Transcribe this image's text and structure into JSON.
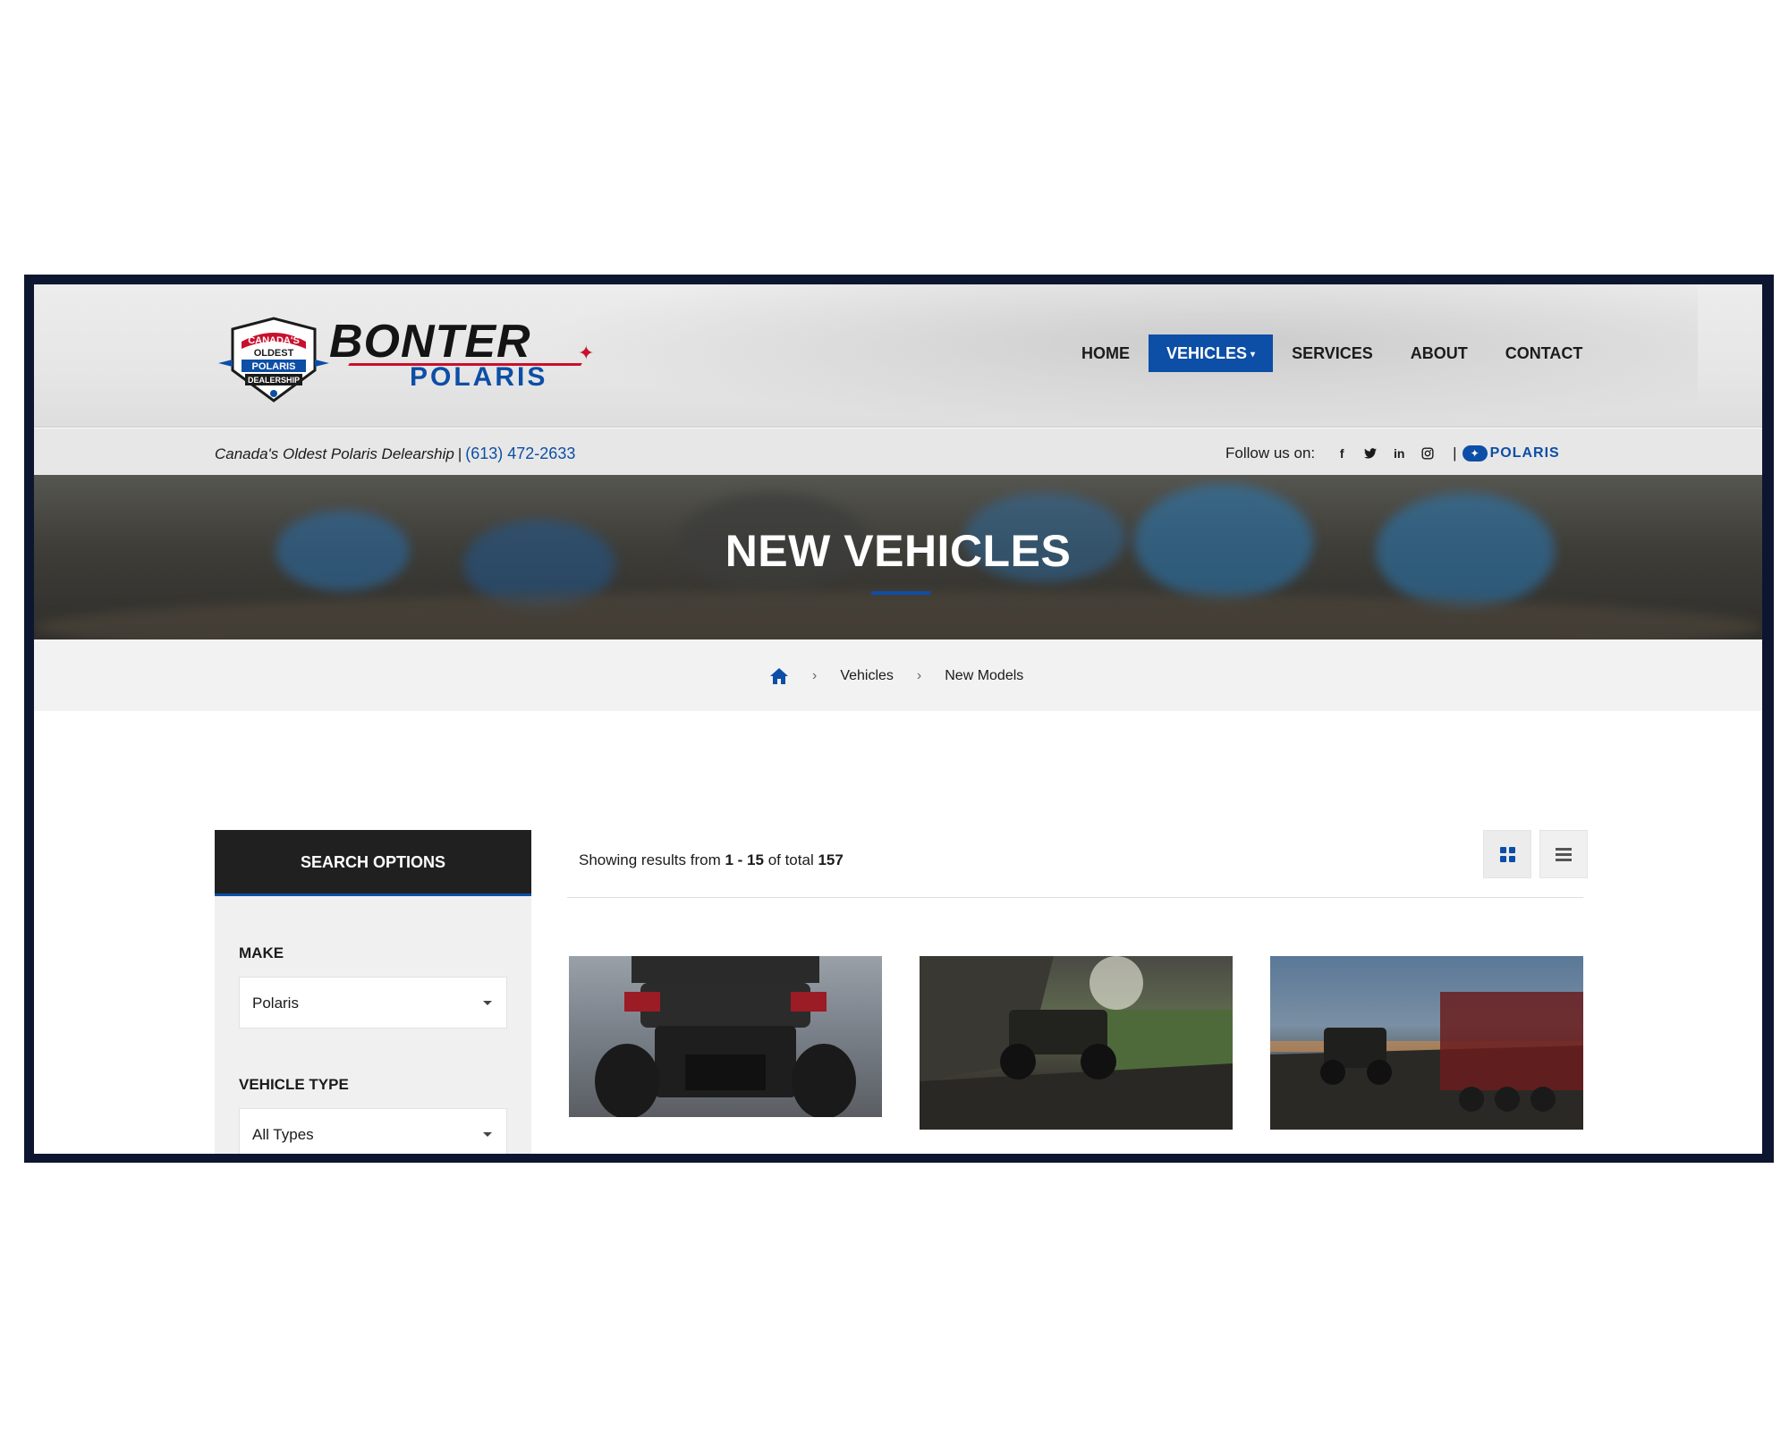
{
  "brand": {
    "badge_line1": "CANADA'S",
    "badge_line2": "OLDEST",
    "badge_line3": "POLARIS",
    "badge_line4": "DEALERSHIP",
    "name": "BONTER",
    "sub": "POLARIS"
  },
  "nav": {
    "items": [
      {
        "label": "HOME"
      },
      {
        "label": "VEHICLES"
      },
      {
        "label": "SERVICES"
      },
      {
        "label": "ABOUT"
      },
      {
        "label": "CONTACT"
      }
    ],
    "active": "VEHICLES"
  },
  "subbar": {
    "tagline": "Canada's Oldest Polaris Delearship",
    "separator": "|",
    "phone": "(613) 472-2633",
    "follow_label": "Follow us on:",
    "socials": [
      {
        "icon": "facebook-icon",
        "glyph": "f"
      },
      {
        "icon": "twitter-icon",
        "glyph": "🐦"
      },
      {
        "icon": "linkedin-icon",
        "glyph": "in"
      },
      {
        "icon": "instagram-icon",
        "glyph": "◎"
      }
    ],
    "partner_pipe": "|",
    "partner_logo": "POLARIS"
  },
  "hero": {
    "title": "NEW VEHICLES"
  },
  "breadcrumb": {
    "home_icon": "home-icon",
    "items": [
      "Vehicles",
      "New Models"
    ]
  },
  "sidebar": {
    "heading": "SEARCH OPTIONS",
    "make_label": "MAKE",
    "make_value": "Polaris",
    "type_label": "VEHICLE TYPE",
    "type_value": "All Types"
  },
  "results": {
    "prefix": "Showing results from",
    "range": "1 - 15",
    "middle": "of total",
    "total": "157",
    "view_grid_icon": "grid-view-icon",
    "view_list_icon": "list-view-icon"
  },
  "colors": {
    "accent": "#0d4ea6",
    "dark": "#202020",
    "frame": "#0d1630",
    "maple": "#c8102e"
  }
}
